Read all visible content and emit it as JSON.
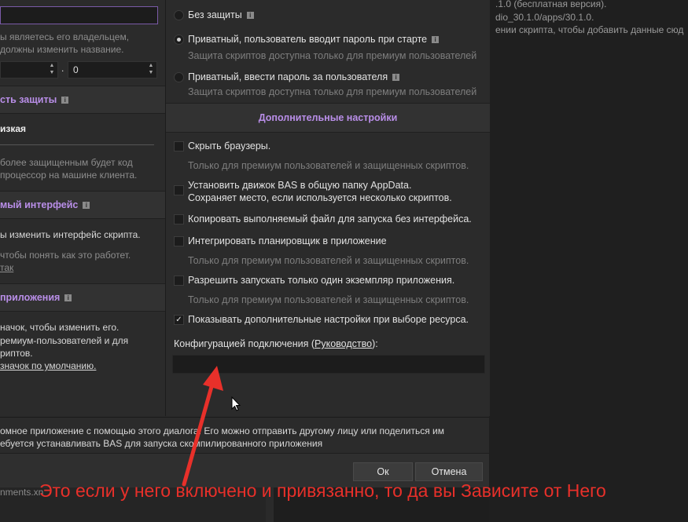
{
  "background": {
    "lines": [
      ".1.0 (бесплатная версия).",
      "dio_30.1.0/apps/30.1.0.",
      "ении скрипта, чтобы добавить данные сюд"
    ],
    "bottom_text": "nments.xn"
  },
  "left": {
    "name_text": [
      "ы являетесь его владельцем,",
      "должны изменить название."
    ],
    "version": {
      "major": "",
      "minor": "0",
      "dot": "."
    },
    "protection_section": "сть защиты",
    "protection_value": "изкая",
    "protection_desc": [
      "более защищенным будет код",
      "процессор на машине клиента."
    ],
    "ui_section": "мый интерфейс",
    "ui_desc": [
      "ы изменить интерфейс скрипта.",
      "чтобы понять как это работет.",
      "так"
    ],
    "app_section": "приложения",
    "app_desc": [
      "начок, чтобы изменить его.",
      "ремиум-пользователей и для",
      "риптов.",
      "значок по умолчанию."
    ]
  },
  "right": {
    "options": [
      {
        "label": "Без защиты",
        "note": ""
      },
      {
        "label": "Приватный, пользователь вводит пароль при старте",
        "note": "Защита скриптов доступна только для премиум пользователей"
      },
      {
        "label": "Приватный, ввести пароль за пользователя",
        "note": "Защита скриптов доступна только для премиум пользователей"
      }
    ],
    "advanced_title": "Дополнительные настройки",
    "checks": [
      {
        "label": "Скрыть браузеры.",
        "note": "Только для премиум пользователей и защищенных скриптов."
      },
      {
        "label": "Установить движок BAS в общую папку AppData.",
        "label2": "Сохраняет место, если используется несколько скриптов.",
        "note": ""
      },
      {
        "label": "Копировать выполняемый файл для запуска без интерфейса.",
        "note": ""
      },
      {
        "label": "Интегрировать планировщик в приложение",
        "note": "Только для премиум пользователей и защищенных скриптов."
      },
      {
        "label": "Разрешить запускать только один экземпляр приложения.",
        "note": "Только для премиум пользователей и защищенных скриптов."
      },
      {
        "label": "Показывать дополнительные настройки при выборе ресурса.",
        "note": ""
      }
    ],
    "config_label_pre": "Конфигурацией подключения (",
    "config_link": "Руководство",
    "config_label_post": "):",
    "config_value": ""
  },
  "bottom_text": [
    "омное приложение с помощью этого диалога. Его можно отправить другому лицу или поделиться им",
    "ебуется устанавливать BAS для запуска скомпилированного приложения"
  ],
  "buttons": {
    "ok": "Ок",
    "cancel": "Отмена"
  },
  "annotation": "Это если у него включено и привязанно, то да вы Зависите от Него",
  "colors": {
    "accent": "#b98ee8",
    "annotation": "#e8302a",
    "background": "#2b2b2b"
  }
}
